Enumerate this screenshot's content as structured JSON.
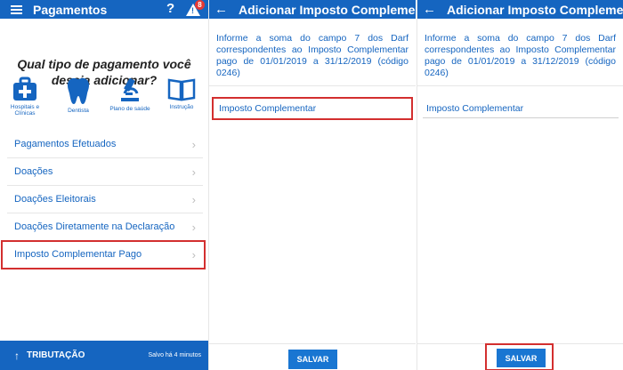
{
  "colors": {
    "primary": "#1565c0",
    "highlight": "#d32f2f",
    "badge": "#e53935"
  },
  "screen1": {
    "title": "Pagamentos",
    "help_icon": "?",
    "badge_count": "8",
    "question": "Qual tipo de pagamento você deseja adicionar?",
    "categories": [
      {
        "label": "Hospitais e Clínicas",
        "icon": "first-aid-kit-icon"
      },
      {
        "label": "Dentista",
        "icon": "tooth-icon"
      },
      {
        "label": "Plano de saúde",
        "icon": "microscope-icon"
      },
      {
        "label": "Instrução",
        "icon": "book-icon"
      }
    ],
    "menu": [
      "Pagamentos Efetuados",
      "Doações",
      "Doações Eleitorais",
      "Doações Diretamente na Declaração",
      "Imposto Complementar Pago"
    ],
    "bottom": {
      "label": "TRIBUTAÇÃO",
      "saved": "Salvo há 4 minutos"
    }
  },
  "screen2": {
    "title": "Adicionar Imposto Complementar",
    "info": "Informe a soma do campo 7 dos Darf correspondentes ao Imposto Complementar pago de 01/01/2019 a 31/12/2019 (código 0246)",
    "field_placeholder": "Imposto Complementar",
    "save_label": "SALVAR"
  },
  "screen3": {
    "title": "Adicionar Imposto Complementar",
    "info": "Informe a soma do campo 7 dos Darf correspondentes ao Imposto Complementar pago de 01/01/2019 a 31/12/2019 (código 0246)",
    "field_placeholder": "Imposto Complementar",
    "save_label": "SALVAR"
  }
}
